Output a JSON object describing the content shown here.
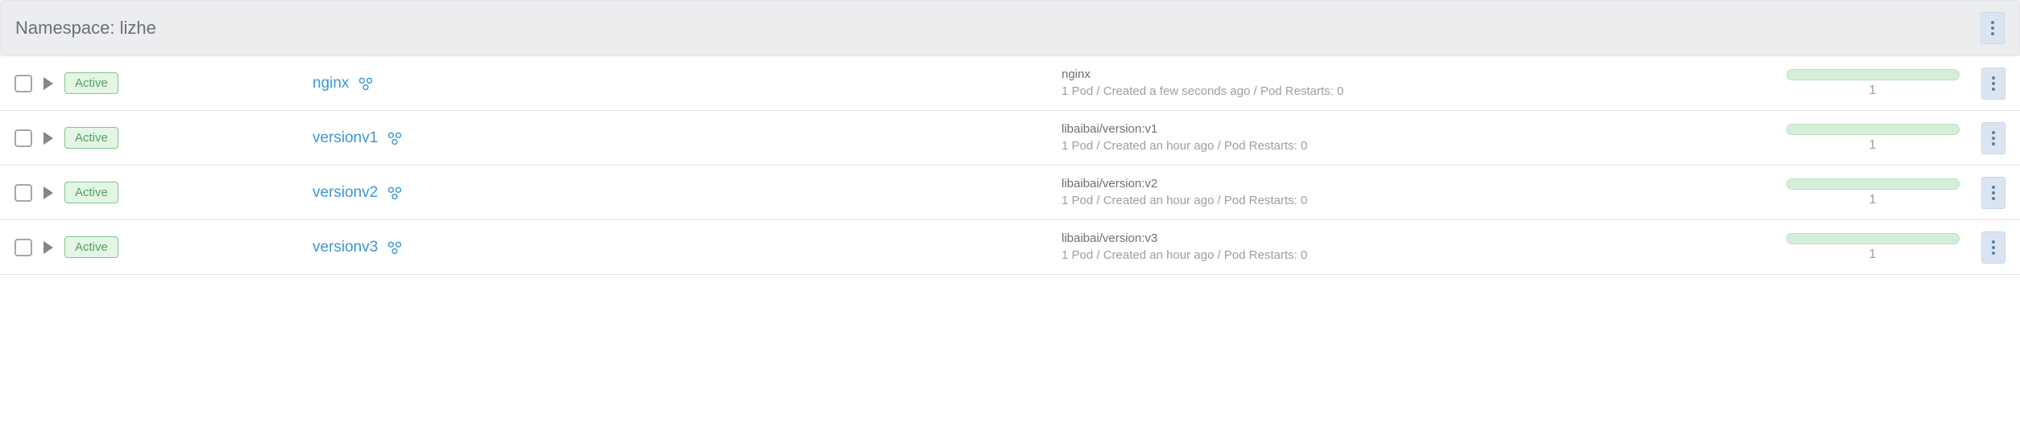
{
  "header": {
    "label": "Namespace: lizhe"
  },
  "status_label": "Active",
  "rows": [
    {
      "name": "nginx",
      "image": "nginx",
      "meta": "1 Pod / Created a few seconds ago / Pod Restarts: 0",
      "count": "1"
    },
    {
      "name": "versionv1",
      "image": "libaibai/version:v1",
      "meta": "1 Pod / Created an hour ago / Pod Restarts: 0",
      "count": "1"
    },
    {
      "name": "versionv2",
      "image": "libaibai/version:v2",
      "meta": "1 Pod / Created an hour ago / Pod Restarts: 0",
      "count": "1"
    },
    {
      "name": "versionv3",
      "image": "libaibai/version:v3",
      "meta": "1 Pod / Created an hour ago / Pod Restarts: 0",
      "count": "1"
    }
  ]
}
